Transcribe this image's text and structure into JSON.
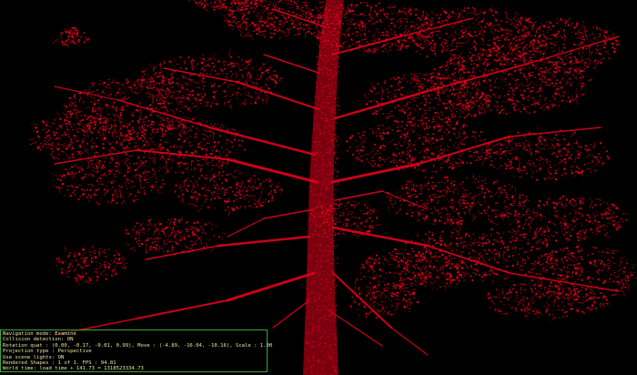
{
  "scene": {
    "object": "point-cloud-tree",
    "point_color": "#e0001b",
    "background_color": "#000000"
  },
  "status_panel": {
    "border_color": "#3fa33f",
    "text_color": "#e6e6a0",
    "lines": [
      "Navigation mode: Examine",
      "Collision detection: ON",
      "Rotation quat : (0.00, -0.17, -0.01, 0.99), Move : (-4.89, -16.04, -10.16), Scale : 1.00",
      "Projection type : Perspective",
      "Use scene lights: ON",
      "Rendered Shapes : 1 of 1. FPS : 94.81",
      "World time: load time + 141.73 = 1318523334.73"
    ]
  }
}
